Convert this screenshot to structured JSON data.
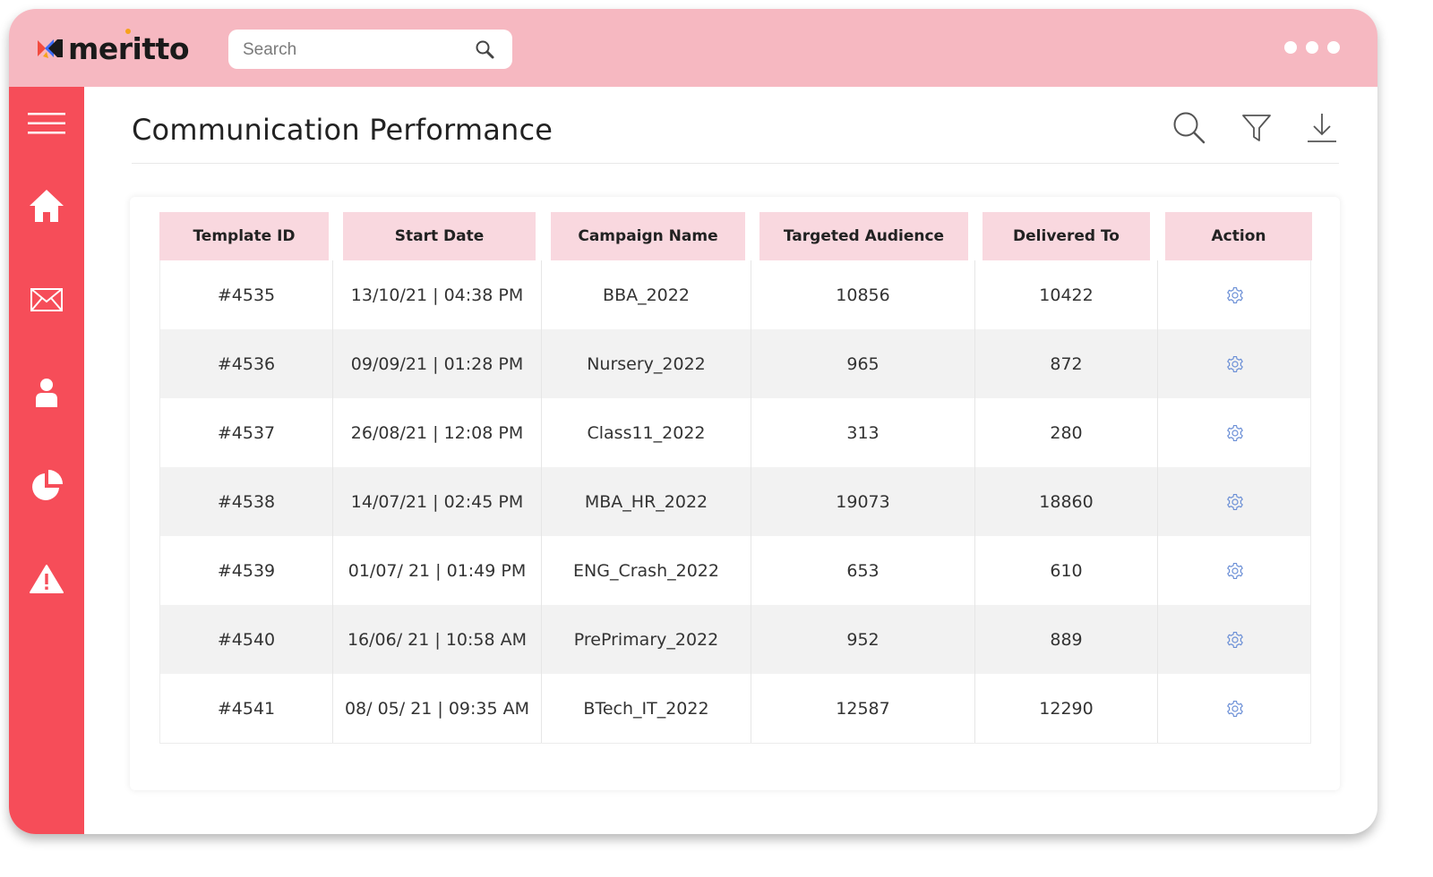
{
  "app": {
    "logo_text": "meritto",
    "search": {
      "placeholder": "Search",
      "value": ""
    }
  },
  "sidebar": {
    "items": [
      {
        "icon": "menu-icon"
      },
      {
        "icon": "home-icon"
      },
      {
        "icon": "mail-icon"
      },
      {
        "icon": "user-icon"
      },
      {
        "icon": "pie-chart-icon"
      },
      {
        "icon": "warning-icon"
      }
    ]
  },
  "page": {
    "title": "Communication Performance",
    "tools": [
      "search-icon",
      "filter-icon",
      "download-icon"
    ]
  },
  "table": {
    "headers": [
      "Template ID",
      "Start Date",
      "Campaign Name",
      "Targeted Audience",
      "Delivered To",
      "Action"
    ],
    "rows": [
      [
        "#4535",
        "13/10/21 | 04:38 PM",
        "BBA_2022",
        "10856",
        "10422"
      ],
      [
        "#4536",
        "09/09/21 | 01:28 PM",
        "Nursery_2022",
        "965",
        "872"
      ],
      [
        "#4537",
        "26/08/21 | 12:08 PM",
        "Class11_2022",
        "313",
        "280"
      ],
      [
        "#4538",
        "14/07/21 | 02:45 PM",
        "MBA_HR_2022",
        "19073",
        "18860"
      ],
      [
        "#4539",
        "01/07/ 21 | 01:49 PM",
        "ENG_Crash_2022",
        "653",
        "610"
      ],
      [
        "#4540",
        "16/06/ 21 | 10:58 AM",
        "PrePrimary_2022",
        "952",
        "889"
      ],
      [
        "#4541",
        "08/ 05/ 21 | 09:35 AM",
        "BTech_IT_2022",
        "12587",
        "12290"
      ]
    ],
    "action_icon": "gear-icon"
  },
  "colors": {
    "topbar": "#f6b8c1",
    "sidebar": "#f64d59",
    "header_cell": "#f9d8df",
    "action_icon": "#6b8fd6"
  }
}
